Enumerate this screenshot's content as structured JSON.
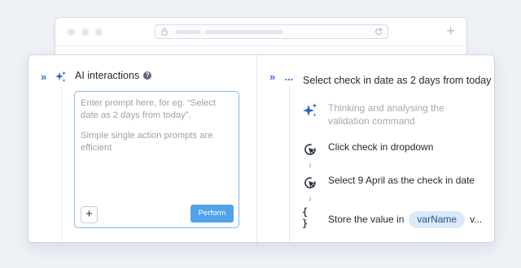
{
  "browser": {
    "icons": [
      "lock-icon",
      "reload-icon",
      "new-tab-plus-icon"
    ],
    "new_tab_label": "+"
  },
  "left_panel": {
    "title": "AI interactions",
    "help_icon": "?",
    "prompt": {
      "placeholder_line1": "Enter prompt here, for eg. “Select date as 2 days from today”.",
      "placeholder_line2": "Simple single action prompts are efficient"
    },
    "add_label": "+",
    "perform_label": "Perform"
  },
  "right_panel": {
    "title": "Select check in date as 2 days from today",
    "steps": [
      {
        "icon": "sparkle-icon",
        "text": "Thinking and analysing the validation command",
        "muted": true
      },
      {
        "icon": "click-cursor-icon",
        "text": "Click check in dropdown"
      },
      {
        "icon": "click-cursor-icon",
        "text": "Select 9 April as the check in date"
      },
      {
        "icon": "curly-braces-icon",
        "text_before": "Store the value in",
        "variable": "varName",
        "text_after": "v..."
      }
    ]
  },
  "colors": {
    "accent": "#3b6fd6",
    "perform_button": "#4ea3ea",
    "input_border": "#8db4ee",
    "variable_pill": "#dbe9fb"
  }
}
